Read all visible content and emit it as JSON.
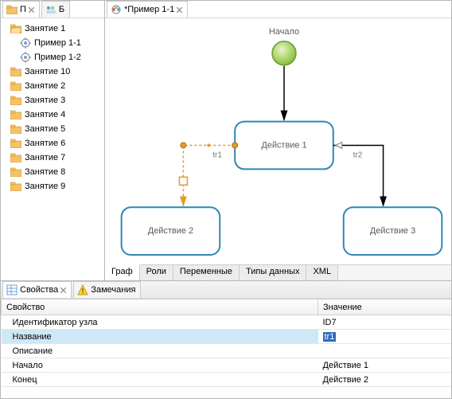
{
  "left_tabs": {
    "project_label": "П",
    "team_label": "Б"
  },
  "tree": {
    "items": [
      {
        "label": "Занятие 1",
        "type": "folder",
        "children": [
          {
            "label": "Пример 1-1",
            "type": "process"
          },
          {
            "label": "Пример 1-2",
            "type": "process"
          }
        ]
      },
      {
        "label": "Занятие 10",
        "type": "folder"
      },
      {
        "label": "Занятие 2",
        "type": "folder"
      },
      {
        "label": "Занятие 3",
        "type": "folder"
      },
      {
        "label": "Занятие 4",
        "type": "folder"
      },
      {
        "label": "Занятие 5",
        "type": "folder"
      },
      {
        "label": "Занятие 6",
        "type": "folder"
      },
      {
        "label": "Занятие 7",
        "type": "folder"
      },
      {
        "label": "Занятие 8",
        "type": "folder"
      },
      {
        "label": "Занятие 9",
        "type": "folder"
      }
    ]
  },
  "editor_tab": {
    "title": "*Пример 1-1"
  },
  "diagram": {
    "start_label": "Начало",
    "action1": "Действие 1",
    "action2": "Действие 2",
    "action3": "Действие 3",
    "tr1": "tr1",
    "tr2": "tr2"
  },
  "editor_tabs": {
    "graph": "Граф",
    "roles": "Роли",
    "vars": "Переменные",
    "types": "Типы данных",
    "xml": "XML"
  },
  "bottom_tabs": {
    "properties": "Свойства",
    "remarks": "Замечания"
  },
  "properties": {
    "header_key": "Свойство",
    "header_val": "Значение",
    "rows": [
      {
        "key": "Идентификатор узла",
        "val": "ID7"
      },
      {
        "key": "Название",
        "val": "tr1",
        "selected": true
      },
      {
        "key": "Описание",
        "val": ""
      },
      {
        "key": "Начало",
        "val": "Действие 1"
      },
      {
        "key": "Конец",
        "val": "Действие 2"
      }
    ]
  }
}
